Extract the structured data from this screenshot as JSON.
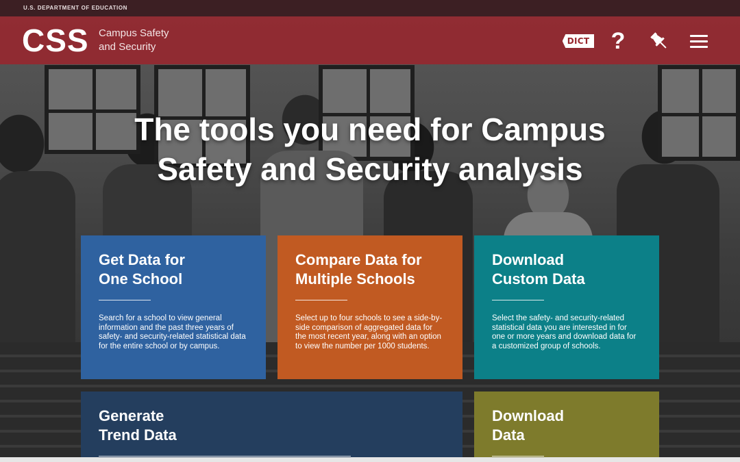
{
  "gov_bar": {
    "text": "U.S. DEPARTMENT OF EDUCATION"
  },
  "header": {
    "logo": "CSS",
    "logo_line1": "Campus Safety",
    "logo_line2": "and Security",
    "icons": {
      "dictionary": "DICT",
      "help": "?",
      "pin": "pin-icon",
      "menu": "menu-icon"
    }
  },
  "hero": {
    "title_line1": "The tools you need for Campus",
    "title_line2": "Safety and Security analysis"
  },
  "cards": [
    {
      "title": "Get Data for\nOne School",
      "description": "Search for a school to view general information and the past three years of safety- and security-related statistical data for the entire school or by campus.",
      "color": "#2f62a0"
    },
    {
      "title": "Compare Data for\nMultiple Schools",
      "description": "Select up to four schools to see a side-by-side comparison of aggregated data for the most recent year, along with an option to view the number per 1000 students.",
      "color": "#c15a22"
    },
    {
      "title": "Download\nCustom Data",
      "description": "Select the safety- and security-related statistical data you are interested in for one or more years and download data for a customized group of schools.",
      "color": "#0c8088"
    },
    {
      "title": "Generate\nTrend Data",
      "color": "#243e5e"
    },
    {
      "title": "Download\nData",
      "color": "#7e7b2c"
    }
  ]
}
